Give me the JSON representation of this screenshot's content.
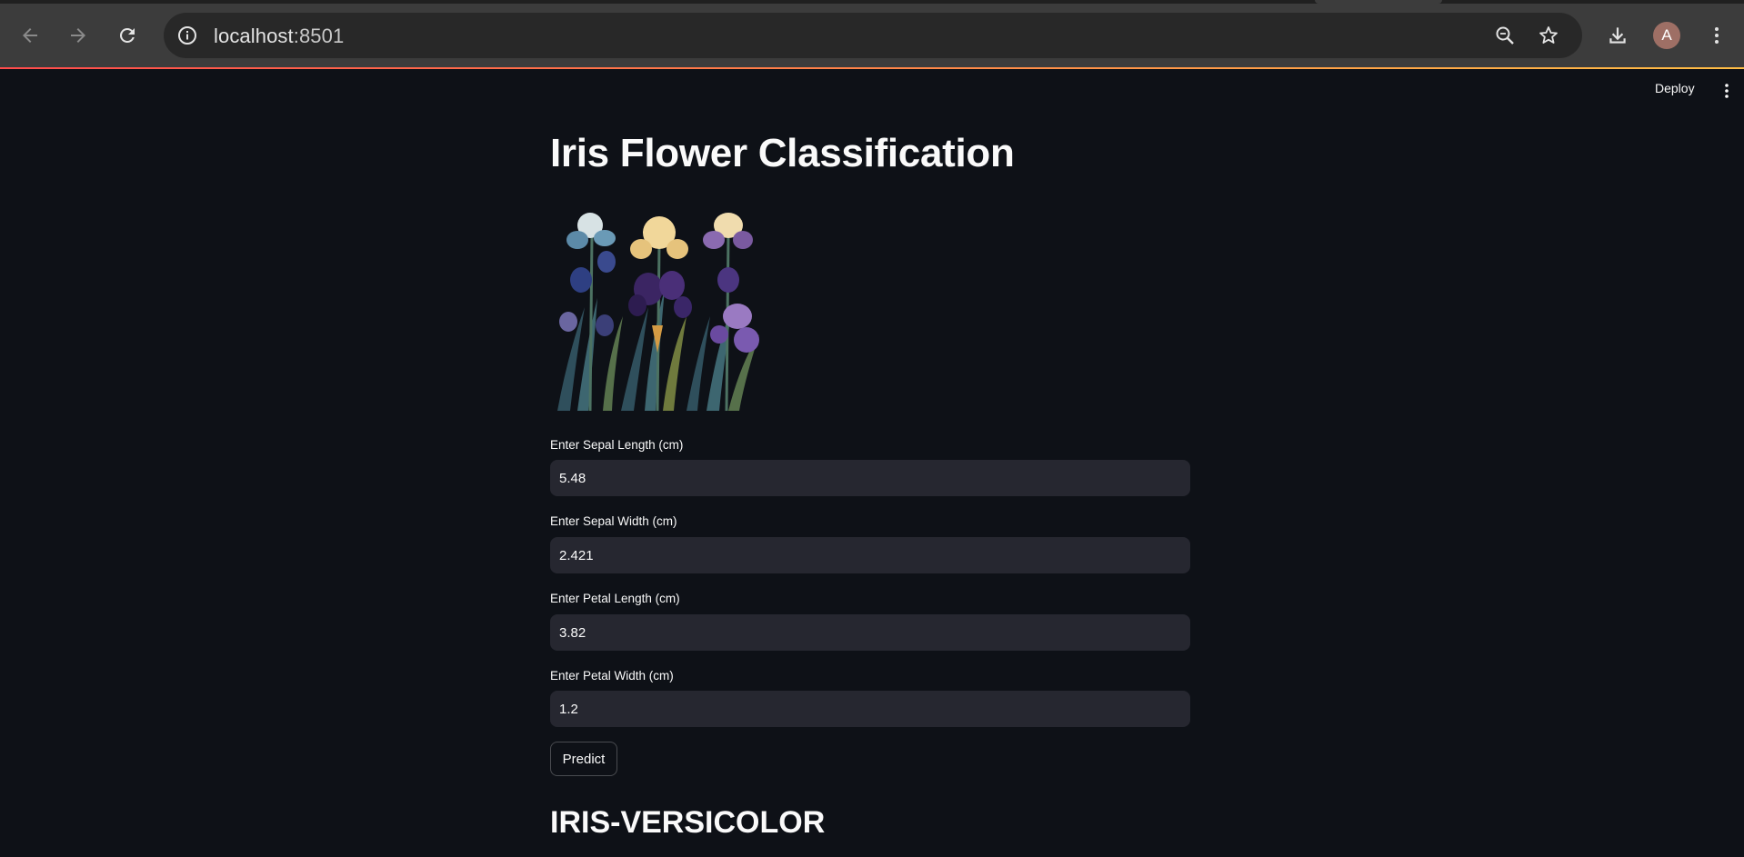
{
  "browser": {
    "url_host": "localhost",
    "url_port": ":8501",
    "profile_initial": "A",
    "icons": {
      "back": "arrow-left-icon",
      "forward": "arrow-right-icon",
      "reload": "reload-icon",
      "site_info": "info-icon",
      "zoom": "zoom-icon",
      "bookmark": "star-icon",
      "downloads": "download-icon",
      "menu": "kebab-icon"
    }
  },
  "app": {
    "deploy_label": "Deploy",
    "title": "Iris Flower Classification",
    "fields": [
      {
        "label": "Enter Sepal Length (cm)",
        "value": "5.48"
      },
      {
        "label": "Enter Sepal Width (cm)",
        "value": "2.421"
      },
      {
        "label": "Enter Petal Length (cm)",
        "value": "3.82"
      },
      {
        "label": "Enter Petal Width (cm)",
        "value": "1.2"
      }
    ],
    "predict_label": "Predict",
    "result": "IRIS-VERSICOLOR"
  },
  "colors": {
    "background": "#0e1117",
    "input_bg": "#262730",
    "text": "#fafafa",
    "accent_red": "#ff4b4b",
    "avatar": "#9e6f65"
  }
}
